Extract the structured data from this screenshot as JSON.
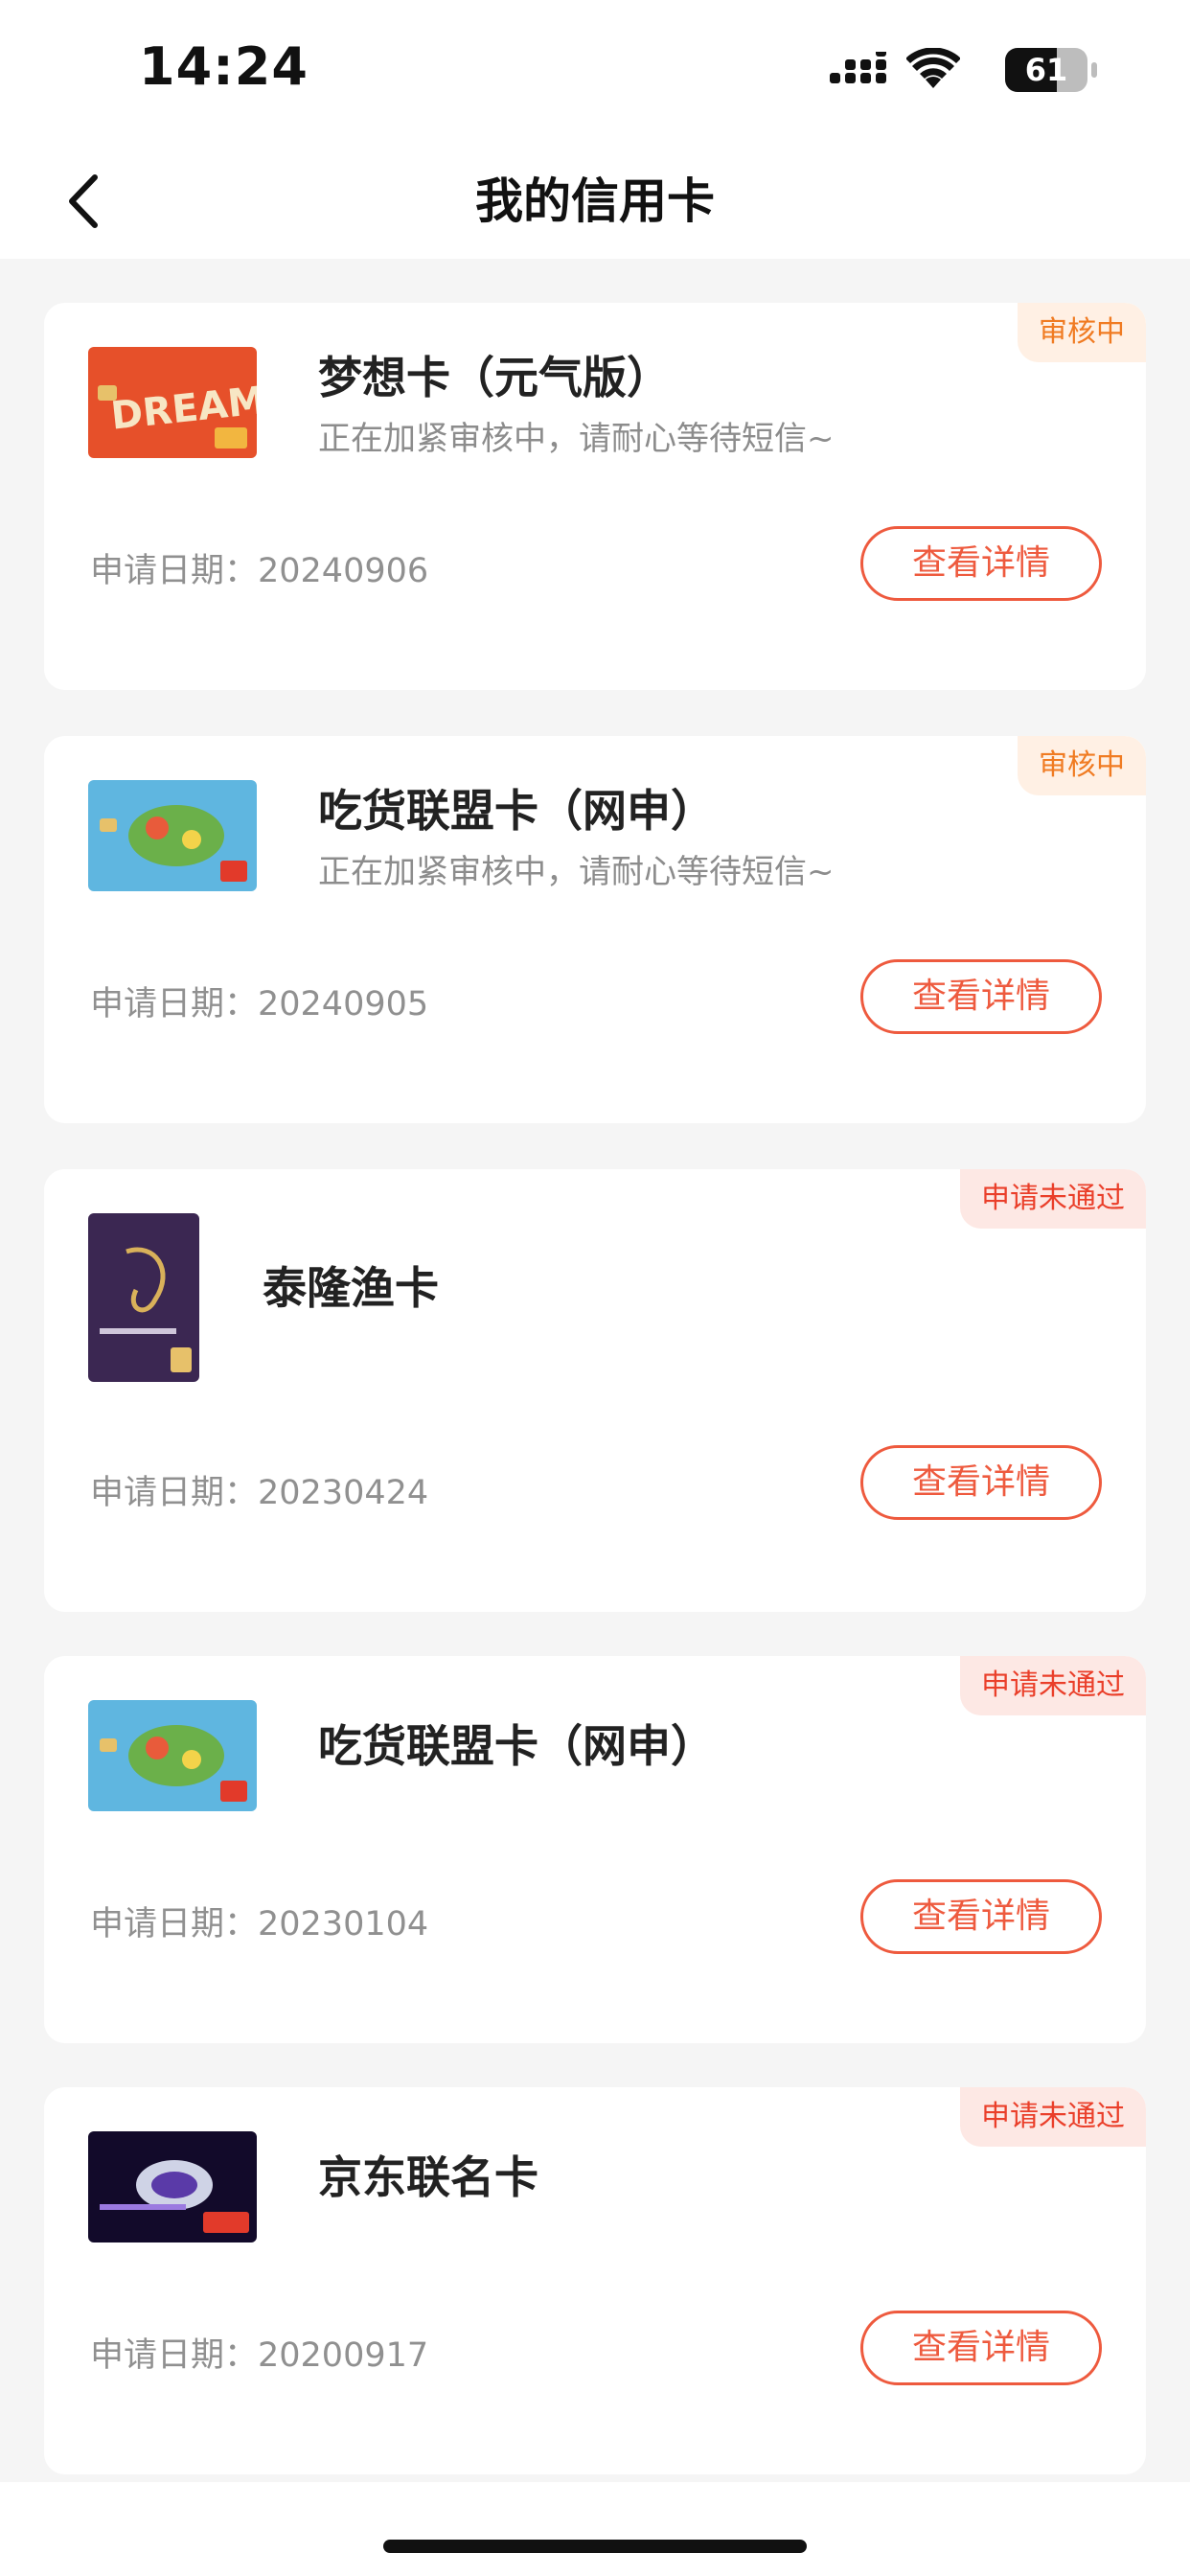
{
  "status_bar": {
    "time": "14:24",
    "battery": "61"
  },
  "nav": {
    "title": "我的信用卡"
  },
  "cards": [
    {
      "name": "梦想卡（元气版）",
      "desc": "正在加紧审核中，请耐心等待短信~",
      "status": "审核中",
      "date": "申请日期：20240906",
      "button": "查看详情",
      "thumb_text": "DREAM"
    },
    {
      "name": "吃货联盟卡（网申）",
      "desc": "正在加紧审核中，请耐心等待短信~",
      "status": "审核中",
      "date": "申请日期：20240905",
      "button": "查看详情"
    },
    {
      "name": "泰隆渔卡",
      "desc": "",
      "status": "申请未通过",
      "date": "申请日期：20230424",
      "button": "查看详情"
    },
    {
      "name": "吃货联盟卡（网申）",
      "desc": "",
      "status": "申请未通过",
      "date": "申请日期：20230104",
      "button": "查看详情"
    },
    {
      "name": "京东联名卡",
      "desc": "",
      "status": "申请未通过",
      "date": "申请日期：20200917",
      "button": "查看详情"
    }
  ],
  "colors": {
    "accent": "#ee5a3e",
    "review_tag_text": "#f07b22",
    "review_tag_bg": "#fff0e4",
    "rejected_tag_text": "#ea3f2a",
    "rejected_tag_bg": "#fde8e4",
    "page_bg": "#f5f5f5"
  }
}
